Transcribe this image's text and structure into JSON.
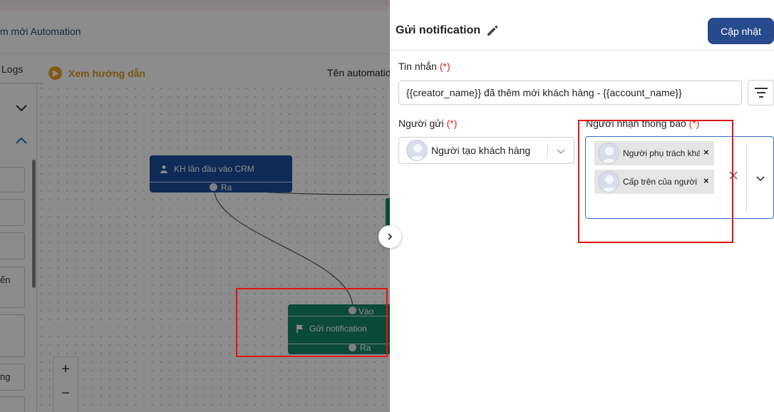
{
  "page": {
    "title": "m mới Automation",
    "logs_tab": "Logs",
    "guide_link": "Xem hướng dẫn",
    "automation_name_label": "Tên automatio"
  },
  "left_panel": {
    "items": [
      "ến",
      "ng"
    ]
  },
  "flow": {
    "trigger_node": {
      "label": "KH lần đầu vào CRM",
      "out_port": "Ra"
    },
    "action_node": {
      "label": "Gửi notification",
      "in_port": "Vào",
      "out_port": "Ra"
    }
  },
  "zoom": {
    "in": "+",
    "out": "−"
  },
  "drawer": {
    "title": "Gửi notification",
    "update_button": "Cập nhật",
    "message_label": "Tin nhắn",
    "message_value": "{{creator_name}} đã thêm mới khách hàng - {{account_name}}",
    "sender_label": "Người gửi",
    "sender_value": "Người tạo khách hàng",
    "receiver_label": "Người nhận thông báo",
    "required_mark": "(*)",
    "receivers": [
      {
        "label": "Người phụ trách khá"
      },
      {
        "label": "Cấp trên của người p"
      }
    ]
  },
  "colors": {
    "primary_button": "#264a8c",
    "trigger_node": "#1e4e9d",
    "action_node": "#15876a",
    "highlight": "#e21313",
    "guide": "#e39a20"
  }
}
